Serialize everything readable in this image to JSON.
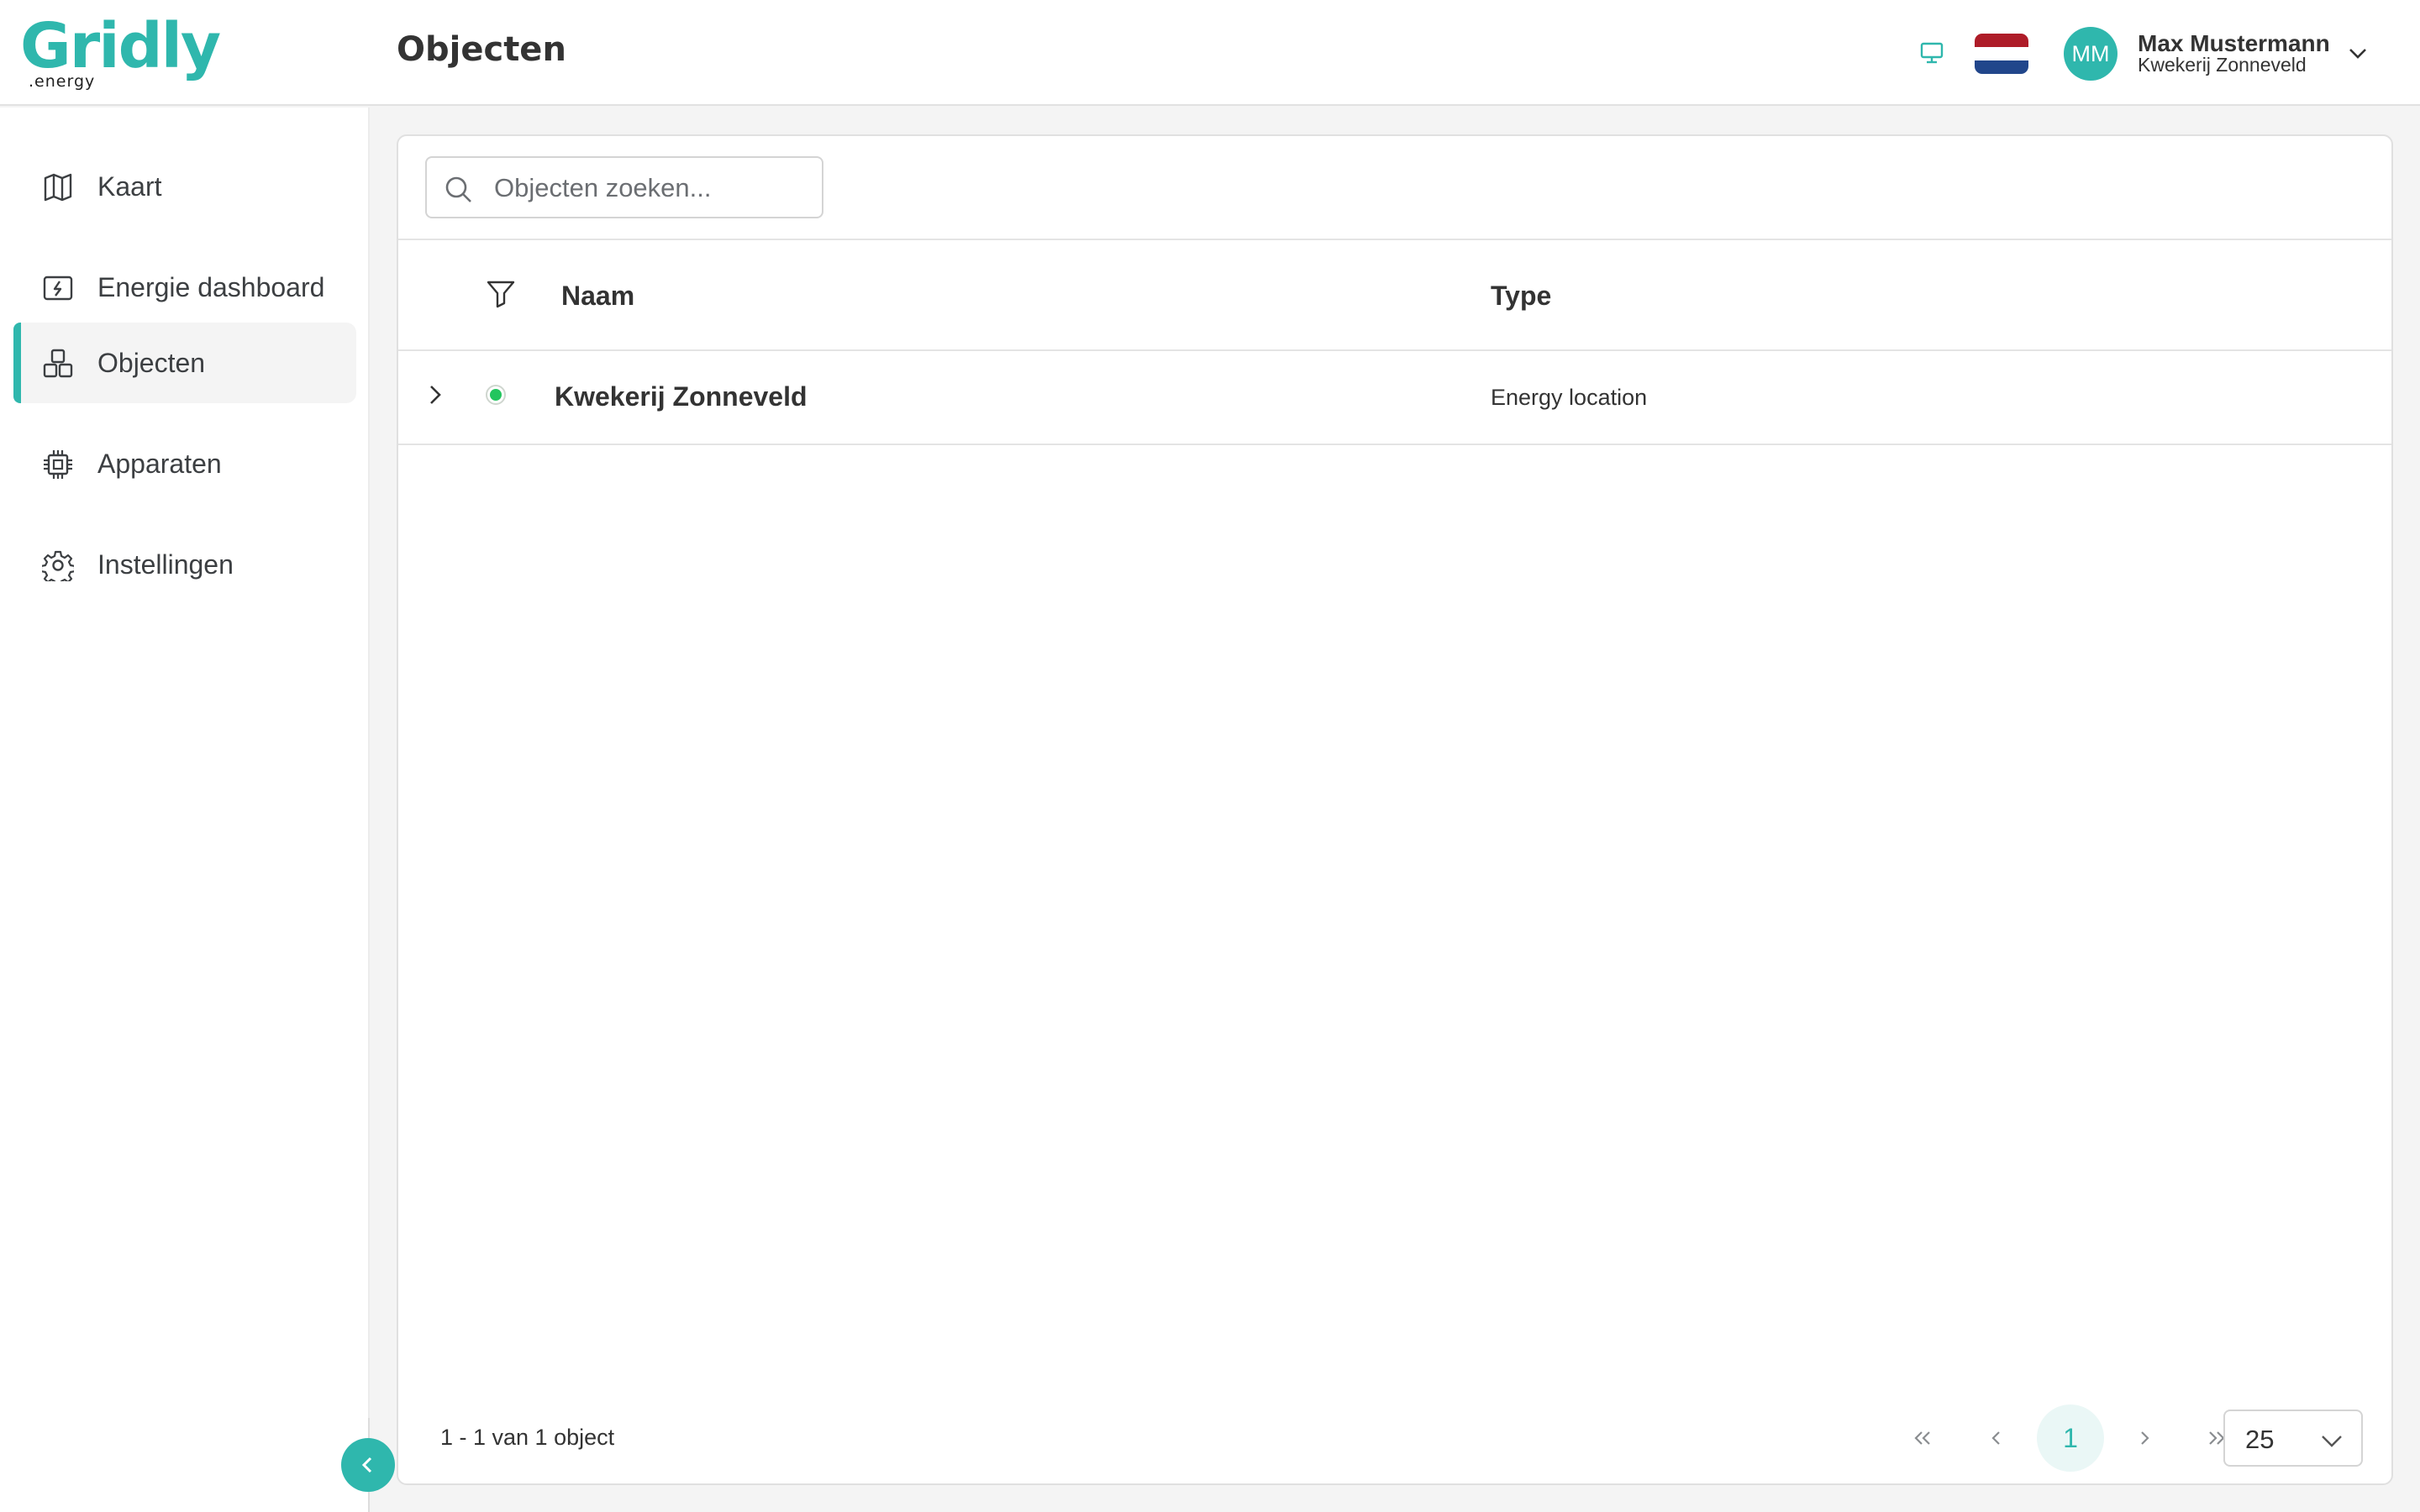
{
  "brand": {
    "name": "Gridly",
    "sub": ".energy",
    "accent": "#2fb7ad"
  },
  "header": {
    "title": "Objecten",
    "user": {
      "initials": "MM",
      "name": "Max Mustermann",
      "organization": "Kwekerij Zonneveld"
    },
    "language_flag": "netherlands-flag-icon"
  },
  "sidebar": {
    "items": [
      {
        "label": "Kaart",
        "icon": "map-icon",
        "active": false
      },
      {
        "label": "Energie dashboard",
        "icon": "energy-dashboard-icon",
        "active": false
      },
      {
        "label": "Objecten",
        "icon": "objects-icon",
        "active": true
      },
      {
        "label": "Apparaten",
        "icon": "chip-icon",
        "active": false
      },
      {
        "label": "Instellingen",
        "icon": "gear-icon",
        "active": false
      }
    ]
  },
  "search": {
    "placeholder": "Objecten zoeken..."
  },
  "table": {
    "columns": [
      "Naam",
      "Type"
    ],
    "rows": [
      {
        "name": "Kwekerij Zonneveld",
        "type": "Energy location",
        "status": "online"
      }
    ]
  },
  "pagination": {
    "summary": "1 - 1 van 1 object",
    "current_page": "1",
    "rows_per_page": "25"
  }
}
